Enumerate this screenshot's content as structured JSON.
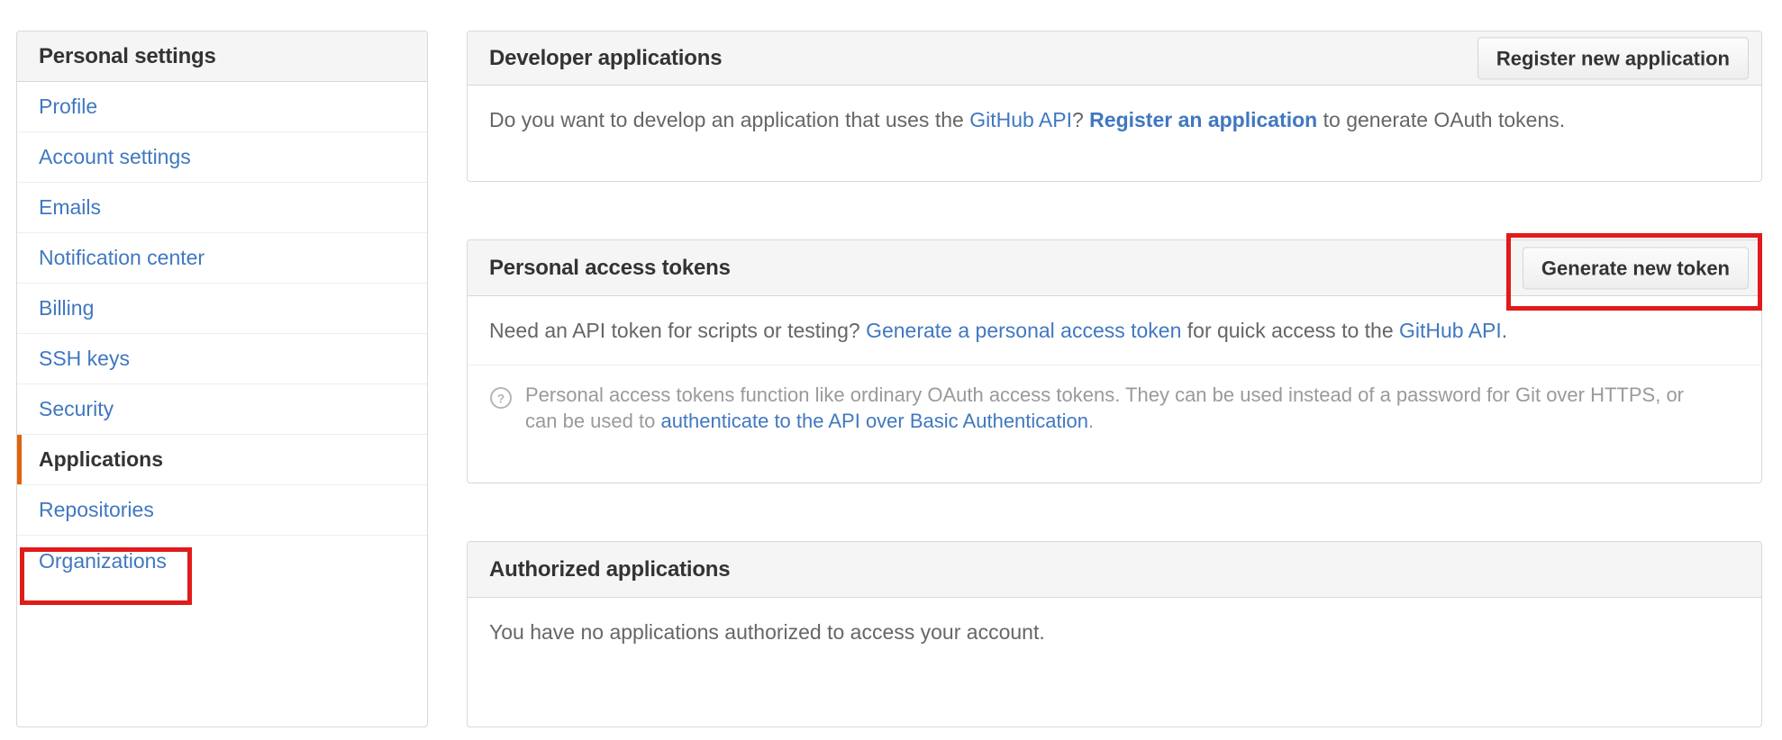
{
  "sidebar": {
    "title": "Personal settings",
    "items": [
      {
        "label": "Profile",
        "selected": false
      },
      {
        "label": "Account settings",
        "selected": false
      },
      {
        "label": "Emails",
        "selected": false
      },
      {
        "label": "Notification center",
        "selected": false
      },
      {
        "label": "Billing",
        "selected": false
      },
      {
        "label": "SSH keys",
        "selected": false
      },
      {
        "label": "Security",
        "selected": false
      },
      {
        "label": "Applications",
        "selected": true
      },
      {
        "label": "Repositories",
        "selected": false
      },
      {
        "label": "Organizations",
        "selected": false
      }
    ]
  },
  "developer_applications": {
    "title": "Developer applications",
    "register_button": "Register new application",
    "body": {
      "part1": "Do you want to develop an application that uses the ",
      "link_github_api": "GitHub API",
      "part2": "? ",
      "link_register": "Register an application",
      "part3": " to generate OAuth tokens."
    }
  },
  "personal_access_tokens": {
    "title": "Personal access tokens",
    "generate_button": "Generate new token",
    "body": {
      "part1": "Need an API token for scripts or testing? ",
      "link_generate": "Generate a personal access token",
      "part2": " for quick access to the ",
      "link_github_api": "GitHub API",
      "part3": "."
    },
    "note": {
      "icon": "question-circle-icon",
      "part1": "Personal access tokens function like ordinary OAuth access tokens. They can be used instead of a password for Git over HTTPS, or can be used to ",
      "link_authenticate": "authenticate to the API over Basic Authentication",
      "part2": "."
    }
  },
  "authorized_applications": {
    "title": "Authorized applications",
    "empty_message": "You have no applications authorized to access your account."
  },
  "annotations": {
    "color": "#e01b1b",
    "boxes": [
      {
        "name": "applications-highlight",
        "target": "Applications"
      },
      {
        "name": "generate-new-token-highlight",
        "target": "Generate new token"
      }
    ]
  },
  "colors": {
    "link": "#4078c0",
    "active_indicator": "#e36209",
    "header_bg": "#f5f5f5",
    "border": "#d8d8d8",
    "annotation_red": "#e01b1b"
  }
}
